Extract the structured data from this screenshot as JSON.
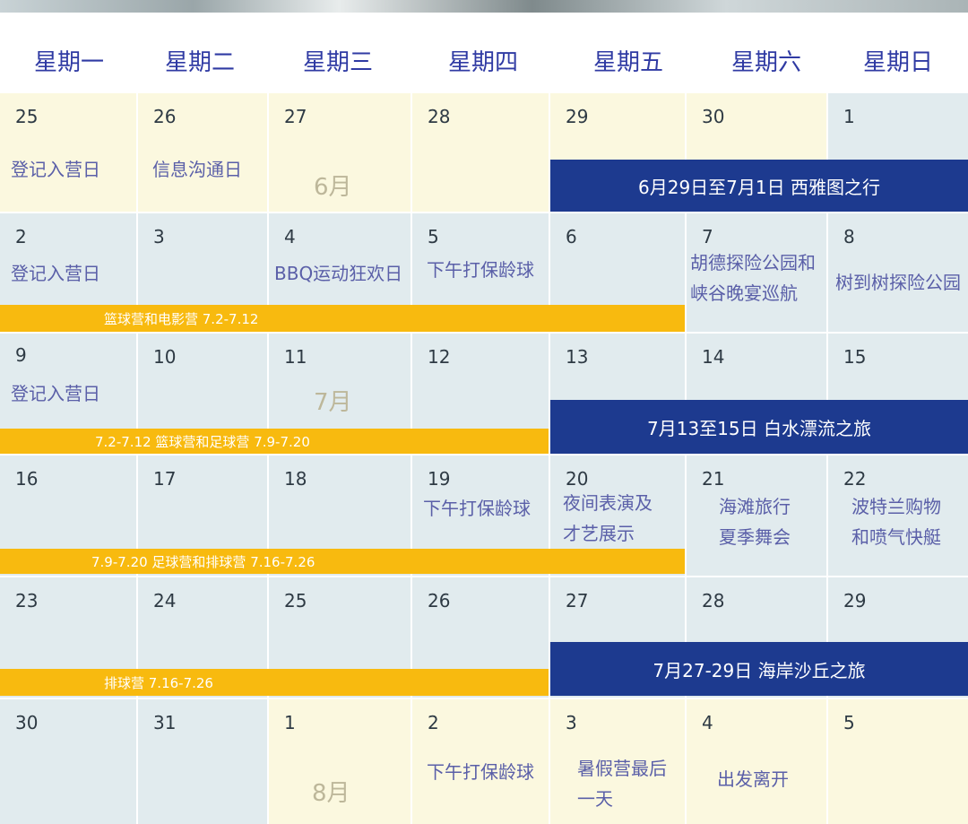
{
  "weekdays": [
    "星期一",
    "星期二",
    "星期三",
    "星期四",
    "星期五",
    "星期六",
    "星期日"
  ],
  "weeks": [
    {
      "days": [
        "25",
        "26",
        "27",
        "28",
        "29",
        "30",
        "1"
      ]
    },
    {
      "days": [
        "2",
        "3",
        "4",
        "5",
        "6",
        "7",
        "8"
      ]
    },
    {
      "days": [
        "9",
        "10",
        "11",
        "12",
        "13",
        "14",
        "15"
      ]
    },
    {
      "days": [
        "16",
        "17",
        "18",
        "19",
        "20",
        "21",
        "22"
      ]
    },
    {
      "days": [
        "23",
        "24",
        "25",
        "26",
        "27",
        "28",
        "29"
      ]
    },
    {
      "days": [
        "30",
        "31",
        "1",
        "2",
        "3",
        "4",
        "5"
      ]
    }
  ],
  "months": {
    "june": "6月",
    "july": "7月",
    "august": "8月"
  },
  "events": {
    "w1_mon": "登记入营日",
    "w1_tue": "信息沟通日",
    "w2_mon": "登记入营日",
    "w2_wed": "BBQ运动狂欢日",
    "w2_thu": "下午打保龄球",
    "w2_sat_1": "胡德探险公园和",
    "w2_sat_2": "峡谷晚宴巡航",
    "w2_sun": "树到树探险公园",
    "w3_mon": "登记入营日",
    "w4_thu": "下午打保龄球",
    "w4_fri_1": "夜间表演及",
    "w4_fri_2": "才艺展示",
    "w4_sat_1": "海滩旅行",
    "w4_sat_2": "夏季舞会",
    "w4_sun_1": "波特兰购物",
    "w4_sun_2": "和喷气快艇",
    "w6_thu": "下午打保龄球",
    "w6_fri_1": "暑假营最后",
    "w6_fri_2": "一天",
    "w6_sat": "出发离开"
  },
  "trips": {
    "seattle": "6月29日至7月1日 西雅图之行",
    "rafting": "7月13至15日 白水漂流之旅",
    "dunes": "7月27-29日 海岸沙丘之旅"
  },
  "camps": {
    "basketball_film": "篮球营和电影营 7.2-7.12",
    "basketball_soccer": "7.2-7.12 篮球营和足球营 7.9-7.20",
    "soccer_volleyball": "7.9-7.20 足球营和排球营 7.16-7.26",
    "volleyball": "排球营 7.16-7.26"
  },
  "colors": {
    "header_text": "#2f3aa3",
    "event_text": "#5a5fa8",
    "navy_band": "#1d3a8f",
    "orange_band": "#f8ba0f",
    "june_august_cell": "#fbf8df",
    "july_cell": "#e1ebee"
  }
}
